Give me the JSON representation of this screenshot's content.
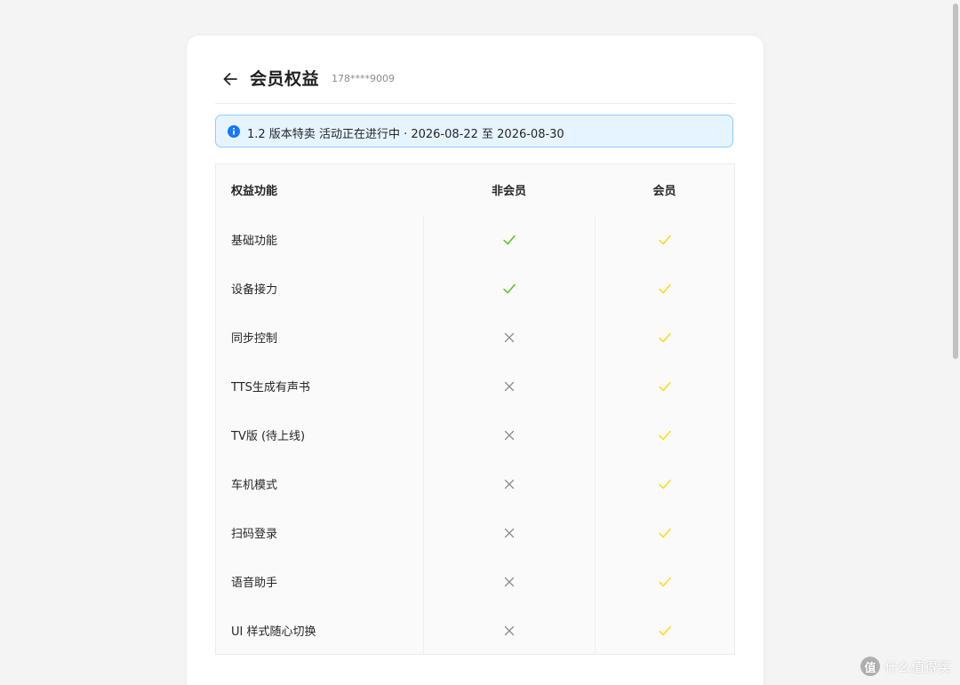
{
  "header": {
    "title": "会员权益",
    "account_id": "178****9009"
  },
  "notice": {
    "text": "1.2 版本特卖 活动正在进行中 · 2026-08-22 至 2026-08-30",
    "accent_color": "#1677ff",
    "background_color": "#e6f4ff",
    "border_color": "#91caff"
  },
  "table": {
    "columns": [
      "权益功能",
      "非会员",
      "会员"
    ],
    "rows": [
      {
        "feature": "基础功能",
        "free": "check",
        "member": "check"
      },
      {
        "feature": "设备接力",
        "free": "check",
        "member": "check"
      },
      {
        "feature": "同步控制",
        "free": "cross",
        "member": "check"
      },
      {
        "feature": "TTS生成有声书",
        "free": "cross",
        "member": "check"
      },
      {
        "feature": "TV版 (待上线)",
        "free": "cross",
        "member": "check"
      },
      {
        "feature": "车机模式",
        "free": "cross",
        "member": "check"
      },
      {
        "feature": "扫码登录",
        "free": "cross",
        "member": "check"
      },
      {
        "feature": "语音助手",
        "free": "cross",
        "member": "check"
      },
      {
        "feature": "UI 样式随心切换",
        "free": "cross",
        "member": "check"
      }
    ],
    "colors": {
      "free_check": "#52c41a",
      "member_check": "#fadb14",
      "cross": "#8c8c8c"
    }
  },
  "watermark": {
    "badge": "值",
    "text": "什么值得买"
  }
}
